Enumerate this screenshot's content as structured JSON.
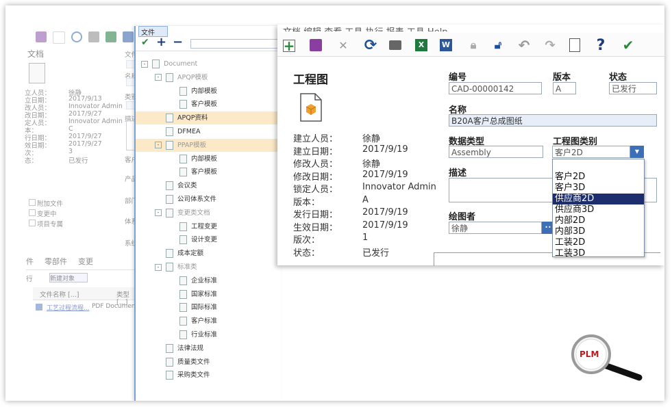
{
  "background_window": {
    "doc_title": "文档",
    "fields": [
      {
        "label": "立人员：",
        "value": "徐静"
      },
      {
        "label": "立日期：",
        "value": "2017/9/13"
      },
      {
        "label": "改人员：",
        "value": "Innovator Admin"
      },
      {
        "label": "改日期：",
        "value": "2017/9/27"
      },
      {
        "label": "定人员：",
        "value": "Innovator Admin"
      },
      {
        "label": "本：",
        "value": "C"
      },
      {
        "label": "行日期：",
        "value": "2017/9/27"
      },
      {
        "label": "效日期：",
        "value": "2017/9/27"
      },
      {
        "label": "次：",
        "value": "3"
      },
      {
        "label": "态：",
        "value": "已发行"
      }
    ],
    "side_labels": [
      "文件",
      "名称",
      "类别",
      "描述",
      "客户",
      "产品",
      "部门",
      "体系",
      "系统"
    ],
    "checkboxes": [
      {
        "label": "附加文件"
      },
      {
        "label": "变更中"
      },
      {
        "label": "项目专属"
      }
    ],
    "tabs": [
      "件",
      "零部件",
      "变更"
    ],
    "action_label": "行",
    "new_object": "新建对象",
    "table_headers": [
      "文件名称 [...]",
      "类型 [...]"
    ],
    "table_rows": [
      {
        "name": "工艺过程流程...",
        "type": "PDF Document"
      }
    ]
  },
  "tree": {
    "tab_label": "文件",
    "nodes": [
      {
        "label": "Document",
        "level": 0,
        "exp": "-",
        "gray": true
      },
      {
        "label": "APQP模板",
        "level": 1,
        "exp": "-",
        "gray": true
      },
      {
        "label": "内部模板",
        "level": 2
      },
      {
        "label": "客户模板",
        "level": 2
      },
      {
        "label": "APQP资料",
        "level": 1,
        "highlight": true
      },
      {
        "label": "DFMEA",
        "level": 1
      },
      {
        "label": "PPAP模板",
        "level": 1,
        "exp": "-",
        "gray": true,
        "highlight": true
      },
      {
        "label": "内部模板",
        "level": 2
      },
      {
        "label": "客户模板",
        "level": 2
      },
      {
        "label": "会议类",
        "level": 1
      },
      {
        "label": "公司体系文件",
        "level": 1
      },
      {
        "label": "变更类文档",
        "level": 1,
        "exp": "-",
        "gray": true
      },
      {
        "label": "工程变更",
        "level": 2
      },
      {
        "label": "设计变更",
        "level": 2
      },
      {
        "label": "成本定额",
        "level": 1
      },
      {
        "label": "标准类",
        "level": 1,
        "exp": "-",
        "gray": true
      },
      {
        "label": "企业标准",
        "level": 2
      },
      {
        "label": "国家标准",
        "level": 2
      },
      {
        "label": "国际标准",
        "level": 2
      },
      {
        "label": "客户标准",
        "level": 2
      },
      {
        "label": "行业标准",
        "level": 2
      },
      {
        "label": "法律法规",
        "level": 1
      },
      {
        "label": "质量类文件",
        "level": 1
      },
      {
        "label": "采购类文件",
        "level": 1
      }
    ]
  },
  "main": {
    "menu_text": "文档   编辑   查看   工具   执行   报表   工具   Help",
    "title": "工程图",
    "info": [
      {
        "label": "建立人员：",
        "value": "徐静"
      },
      {
        "label": "建立日期：",
        "value": "2017/9/19"
      },
      {
        "label": "修改人员：",
        "value": "徐静"
      },
      {
        "label": "修改日期：",
        "value": "2017/9/19"
      },
      {
        "label": "锁定人员：",
        "value": "Innovator Admin"
      },
      {
        "label": "版本：",
        "value": "A"
      },
      {
        "label": "发行日期：",
        "value": "2017/9/19"
      },
      {
        "label": "生效日期：",
        "value": "2017/9/19"
      },
      {
        "label": "版次：",
        "value": "1"
      },
      {
        "label": "状态：",
        "value": "已发行"
      }
    ],
    "form": {
      "number_label": "编号",
      "number_value": "CAD-00000142",
      "version_label": "版本",
      "version_value": "A",
      "status_label": "状态",
      "status_value": "已发行",
      "name_label": "名称",
      "name_value": "B20A客户总成图纸",
      "datatype_label": "数据类型",
      "datatype_value": "Assembly",
      "drawing_type_label": "工程图类别",
      "drawing_type_value": "客户2D",
      "desc_label": "描述",
      "drafter_label": "绘图者",
      "drafter_value": "徐静"
    },
    "dropdown_options": [
      "",
      "客户2D",
      "客户3D",
      "供应商2D",
      "供应商3D",
      "内部2D",
      "内部3D",
      "工装2D",
      "工装3D"
    ],
    "dropdown_selected": "供应商2D"
  },
  "logo_text": "PLM"
}
